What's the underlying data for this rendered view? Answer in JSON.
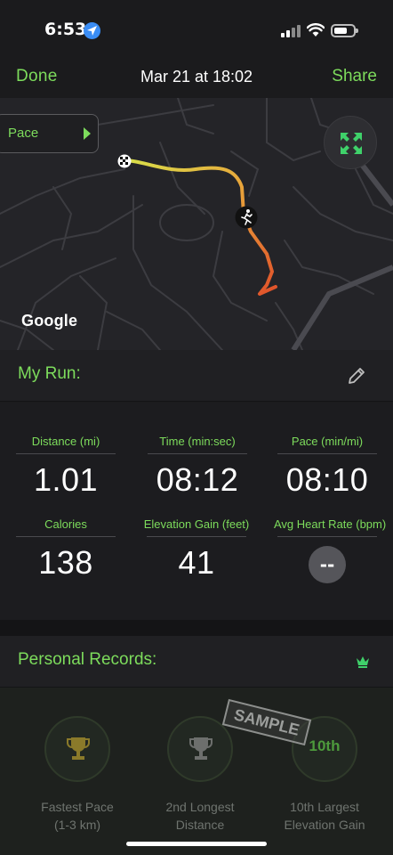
{
  "status_bar": {
    "time": "6:53"
  },
  "nav": {
    "done_label": "Done",
    "title": "Mar 21 at 18:02",
    "share_label": "Share"
  },
  "map": {
    "metric_selector": "Pace",
    "attribution": "Google"
  },
  "my_run": {
    "title": "My Run:",
    "stats": [
      {
        "label": "Distance (mi)",
        "value": "1.01"
      },
      {
        "label": "Time (min:sec)",
        "value": "08:12"
      },
      {
        "label": "Pace (min/mi)",
        "value": "08:10"
      },
      {
        "label": "Calories",
        "value": "138"
      },
      {
        "label": "Elevation Gain (feet)",
        "value": "41"
      },
      {
        "label": "Avg Heart Rate (bpm)",
        "value": "--"
      }
    ]
  },
  "personal_records": {
    "title": "Personal Records:",
    "stamp": "SAMPLE",
    "items": [
      {
        "label_line1": "Fastest Pace",
        "label_line2": "(1-3 km)",
        "icon": "trophy-gold-icon"
      },
      {
        "label_line1": "2nd Longest",
        "label_line2": "Distance",
        "icon": "trophy-silver-icon"
      },
      {
        "label_line1": "10th Largest",
        "label_line2": "Elevation Gain",
        "badge": "10th"
      }
    ]
  },
  "colors": {
    "accent": "#7ddc5c",
    "background": "#1b1b1d",
    "route_start": "#d8e04a",
    "route_end": "#e0502a"
  }
}
